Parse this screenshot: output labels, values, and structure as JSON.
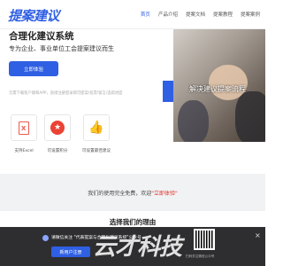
{
  "brand": {
    "logo_text": "提案建议"
  },
  "nav": {
    "items": [
      {
        "label": "首页",
        "active": true
      },
      {
        "label": "产品介绍",
        "active": false
      },
      {
        "label": "提案文档",
        "active": false
      },
      {
        "label": "提案教程",
        "active": false
      },
      {
        "label": "提案案例",
        "active": false
      }
    ]
  },
  "hero": {
    "title": "合理化建议系统",
    "subtitle": "专为企业、事业单位工会提案建议而生",
    "cta_label": "立即体验",
    "note": "无需下载客户端和APP，直接注册登录即可提案/投票/留言/追踪进度",
    "image_caption": "解决建议提案流程"
  },
  "features": [
    {
      "label": "支持Excel",
      "icon": "excel-icon"
    },
    {
      "label": "可设置积分",
      "icon": "star-badge-icon"
    },
    {
      "label": "可设置最佳建议",
      "icon": "thumbs-up-icon"
    }
  ],
  "band": {
    "text_before": "我们的使用完全免费，欢迎",
    "link_text": "\"立即体验\""
  },
  "why": {
    "title": "选择我们的理由"
  },
  "bottom_bar": {
    "text": "请微信关注 \"代表提案与合理化建议系统\"公众号",
    "button_label": "新用户注册",
    "qr_caption": "扫码关注微信公众号",
    "close_glyph": "×"
  },
  "watermark": {
    "text": "云才科技"
  },
  "colors": {
    "accent": "#2f5fe3",
    "red": "#e0352b"
  }
}
